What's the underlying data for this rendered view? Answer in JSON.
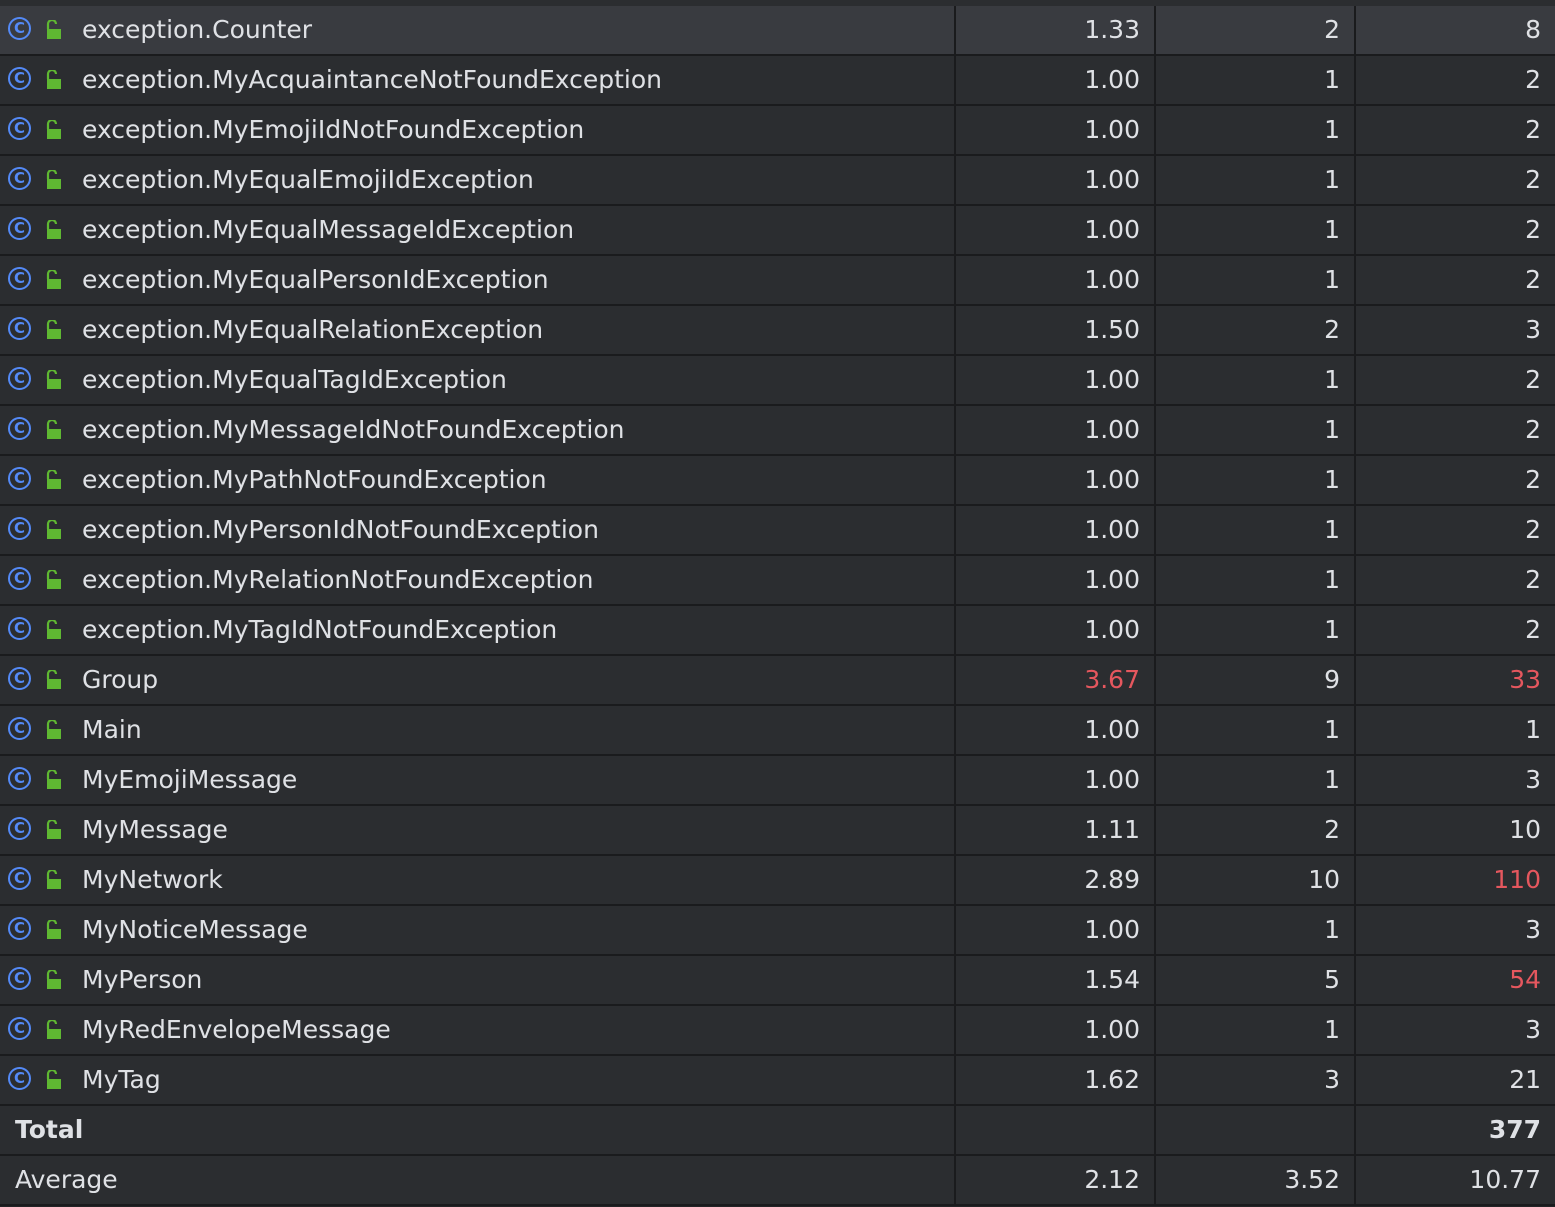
{
  "colors": {
    "background": "#2b2d30",
    "selected_row": "#393b40",
    "text": "#dfe1e5",
    "exceeds_threshold": "#e5575e",
    "class_icon": "#548af7",
    "lock_icon": "#5fb832"
  },
  "icons": [
    "class-icon",
    "lock-icon"
  ],
  "rows": [
    {
      "name": "exception.Counter",
      "c1": "1.33",
      "c2": "2",
      "c3": "8"
    },
    {
      "name": "exception.MyAcquaintanceNotFoundException",
      "c1": "1.00",
      "c2": "1",
      "c3": "2"
    },
    {
      "name": "exception.MyEmojiIdNotFoundException",
      "c1": "1.00",
      "c2": "1",
      "c3": "2"
    },
    {
      "name": "exception.MyEqualEmojiIdException",
      "c1": "1.00",
      "c2": "1",
      "c3": "2"
    },
    {
      "name": "exception.MyEqualMessageIdException",
      "c1": "1.00",
      "c2": "1",
      "c3": "2"
    },
    {
      "name": "exception.MyEqualPersonIdException",
      "c1": "1.00",
      "c2": "1",
      "c3": "2"
    },
    {
      "name": "exception.MyEqualRelationException",
      "c1": "1.50",
      "c2": "2",
      "c3": "3"
    },
    {
      "name": "exception.MyEqualTagIdException",
      "c1": "1.00",
      "c2": "1",
      "c3": "2"
    },
    {
      "name": "exception.MyMessageIdNotFoundException",
      "c1": "1.00",
      "c2": "1",
      "c3": "2"
    },
    {
      "name": "exception.MyPathNotFoundException",
      "c1": "1.00",
      "c2": "1",
      "c3": "2"
    },
    {
      "name": "exception.MyPersonIdNotFoundException",
      "c1": "1.00",
      "c2": "1",
      "c3": "2"
    },
    {
      "name": "exception.MyRelationNotFoundException",
      "c1": "1.00",
      "c2": "1",
      "c3": "2"
    },
    {
      "name": "exception.MyTagIdNotFoundException",
      "c1": "1.00",
      "c2": "1",
      "c3": "2"
    },
    {
      "name": "Group",
      "c1": "3.67",
      "c2": "9",
      "c3": "33"
    },
    {
      "name": "Main",
      "c1": "1.00",
      "c2": "1",
      "c3": "1"
    },
    {
      "name": "MyEmojiMessage",
      "c1": "1.00",
      "c2": "1",
      "c3": "3"
    },
    {
      "name": "MyMessage",
      "c1": "1.11",
      "c2": "2",
      "c3": "10"
    },
    {
      "name": "MyNetwork",
      "c1": "2.89",
      "c2": "10",
      "c3": "110"
    },
    {
      "name": "MyNoticeMessage",
      "c1": "1.00",
      "c2": "1",
      "c3": "3"
    },
    {
      "name": "MyPerson",
      "c1": "1.54",
      "c2": "5",
      "c3": "54"
    },
    {
      "name": "MyRedEnvelopeMessage",
      "c1": "1.00",
      "c2": "1",
      "c3": "3"
    },
    {
      "name": "MyTag",
      "c1": "1.62",
      "c2": "3",
      "c3": "21"
    }
  ],
  "highlighted": {
    "Group": [
      "c1",
      "c3"
    ],
    "MyNetwork": [
      "c3"
    ],
    "MyPerson": [
      "c3"
    ]
  },
  "selected_row": "exception.Counter",
  "summary": {
    "total": {
      "label": "Total",
      "c1": "",
      "c2": "",
      "c3": "377"
    },
    "average": {
      "label": "Average",
      "c1": "2.12",
      "c2": "3.52",
      "c3": "10.77"
    }
  }
}
